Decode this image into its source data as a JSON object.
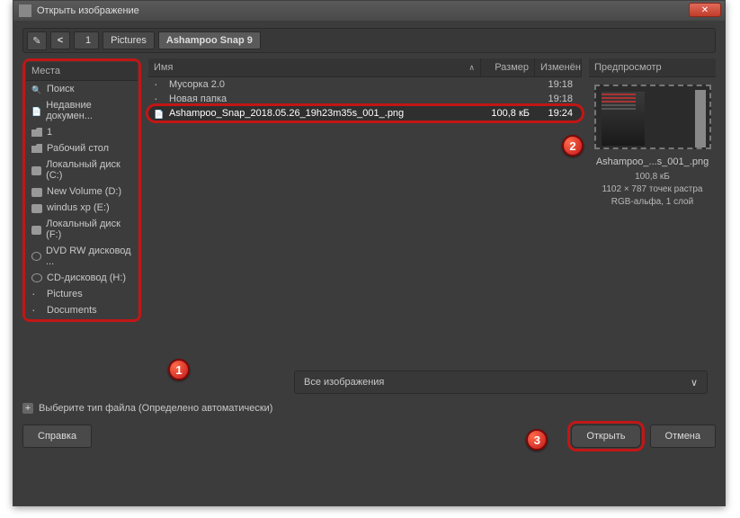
{
  "title": "Открыть изображение",
  "path": {
    "drive": "1",
    "segments": [
      "Pictures",
      "Ashampoo Snap 9"
    ]
  },
  "sidebar": {
    "header": "Места",
    "items": [
      {
        "label": "Поиск",
        "icon": "search"
      },
      {
        "label": "Недавние докумен...",
        "icon": "doc"
      },
      {
        "label": "1",
        "icon": "folder-open"
      },
      {
        "label": "Рабочий стол",
        "icon": "folder"
      },
      {
        "label": "Локальный диск (C:)",
        "icon": "drive"
      },
      {
        "label": "New Volume (D:)",
        "icon": "drive"
      },
      {
        "label": "windus xp (E:)",
        "icon": "drive"
      },
      {
        "label": "Локальный диск (F:)",
        "icon": "drive"
      },
      {
        "label": "DVD RW дисковод ...",
        "icon": "cd"
      },
      {
        "label": "CD-дисковод (H:)",
        "icon": "cd"
      },
      {
        "label": "Pictures",
        "icon": "dot"
      },
      {
        "label": "Documents",
        "icon": "dot"
      }
    ]
  },
  "filecols": {
    "name": "Имя",
    "size": "Размер",
    "modified": "Изменён"
  },
  "files": [
    {
      "name": "Мусорка 2.0",
      "size": "",
      "modified": "19:18",
      "icon": "folder",
      "selected": false
    },
    {
      "name": "Новая папка",
      "size": "",
      "modified": "19:18",
      "icon": "folder",
      "selected": false
    },
    {
      "name": "Ashampoo_Snap_2018.05.26_19h23m35s_001_.png",
      "size": "100,8 кБ",
      "modified": "19:24",
      "icon": "image",
      "selected": true
    }
  ],
  "preview": {
    "header": "Предпросмотр",
    "filename": "Ashampoo_...s_001_.png",
    "size": "100,8 кБ",
    "dimensions": "1102 × 787 точек растра",
    "mode": "RGB-альфа, 1 слой"
  },
  "filter": {
    "label": "Все изображения"
  },
  "typetoggle": "Выберите тип файла (Определено автоматически)",
  "buttons": {
    "help": "Справка",
    "open": "Открыть",
    "cancel": "Отмена"
  },
  "markers": {
    "m1": "1",
    "m2": "2",
    "m3": "3"
  }
}
